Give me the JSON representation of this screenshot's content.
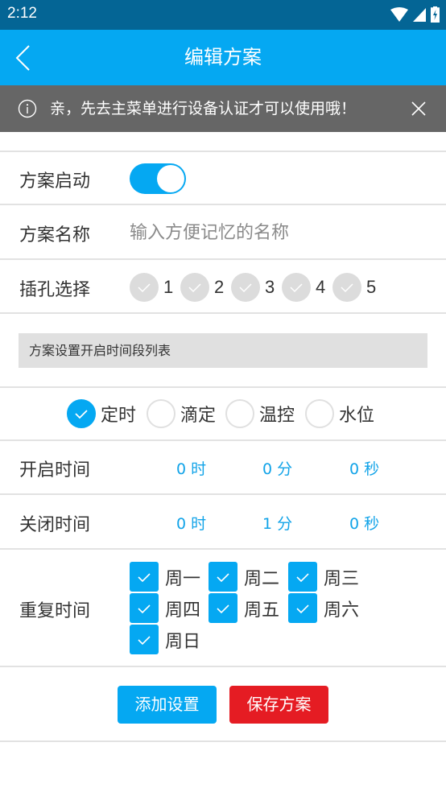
{
  "status_bar": {
    "time": "2:12",
    "icons": [
      "wifi-icon",
      "cellular-signal-icon",
      "battery-charging-icon"
    ]
  },
  "app_bar": {
    "title": "编辑方案",
    "back_icon": "chevron-left-icon"
  },
  "notice": {
    "message": "亲，先去主菜单进行设备认证才可以使用哦！",
    "info_icon": "info-circle-icon",
    "close_icon": "close-icon"
  },
  "form": {
    "enable": {
      "label": "方案启动",
      "value": true
    },
    "name": {
      "label": "方案名称",
      "value": "",
      "placeholder": "输入方便记忆的名称"
    },
    "sockets": {
      "label": "插孔选择",
      "options": [
        {
          "label": "1",
          "checked": false
        },
        {
          "label": "2",
          "checked": false
        },
        {
          "label": "3",
          "checked": false
        },
        {
          "label": "4",
          "checked": false
        },
        {
          "label": "5",
          "checked": false
        }
      ]
    }
  },
  "section": {
    "title": "方案设置开启时间段列表"
  },
  "modes": {
    "selected": "定时",
    "options": [
      {
        "label": "定时",
        "checked": true
      },
      {
        "label": "滴定",
        "checked": false
      },
      {
        "label": "温控",
        "checked": false
      },
      {
        "label": "水位",
        "checked": false
      }
    ]
  },
  "open_time": {
    "label": "开启时间",
    "hour": "0 时",
    "minute": "0 分",
    "second": "0 秒"
  },
  "close_time": {
    "label": "关闭时间",
    "hour": "0 时",
    "minute": "1 分",
    "second": "0 秒"
  },
  "repeat": {
    "label": "重复时间",
    "days": [
      {
        "label": "周一",
        "checked": true
      },
      {
        "label": "周二",
        "checked": true
      },
      {
        "label": "周三",
        "checked": true
      },
      {
        "label": "周四",
        "checked": true
      },
      {
        "label": "周五",
        "checked": true
      },
      {
        "label": "周六",
        "checked": true
      },
      {
        "label": "周日",
        "checked": true
      }
    ]
  },
  "actions": {
    "add_label": "添加设置",
    "save_label": "保存方案"
  },
  "colors": {
    "status_bar": "#046595",
    "primary": "#05a8f2",
    "notice_bg": "#666666",
    "danger": "#e51c23",
    "section_bg": "#e0e0e0",
    "value_text": "#11a3e8"
  }
}
